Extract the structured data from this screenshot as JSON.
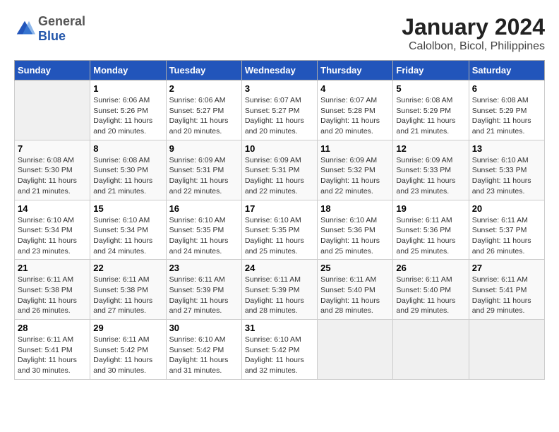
{
  "header": {
    "logo_general": "General",
    "logo_blue": "Blue",
    "title": "January 2024",
    "subtitle": "Calolbon, Bicol, Philippines"
  },
  "weekdays": [
    "Sunday",
    "Monday",
    "Tuesday",
    "Wednesday",
    "Thursday",
    "Friday",
    "Saturday"
  ],
  "weeks": [
    [
      {
        "num": "",
        "sunrise": "",
        "sunset": "",
        "daylight": ""
      },
      {
        "num": "1",
        "sunrise": "Sunrise: 6:06 AM",
        "sunset": "Sunset: 5:26 PM",
        "daylight": "Daylight: 11 hours and 20 minutes."
      },
      {
        "num": "2",
        "sunrise": "Sunrise: 6:06 AM",
        "sunset": "Sunset: 5:27 PM",
        "daylight": "Daylight: 11 hours and 20 minutes."
      },
      {
        "num": "3",
        "sunrise": "Sunrise: 6:07 AM",
        "sunset": "Sunset: 5:27 PM",
        "daylight": "Daylight: 11 hours and 20 minutes."
      },
      {
        "num": "4",
        "sunrise": "Sunrise: 6:07 AM",
        "sunset": "Sunset: 5:28 PM",
        "daylight": "Daylight: 11 hours and 20 minutes."
      },
      {
        "num": "5",
        "sunrise": "Sunrise: 6:08 AM",
        "sunset": "Sunset: 5:29 PM",
        "daylight": "Daylight: 11 hours and 21 minutes."
      },
      {
        "num": "6",
        "sunrise": "Sunrise: 6:08 AM",
        "sunset": "Sunset: 5:29 PM",
        "daylight": "Daylight: 11 hours and 21 minutes."
      }
    ],
    [
      {
        "num": "7",
        "sunrise": "Sunrise: 6:08 AM",
        "sunset": "Sunset: 5:30 PM",
        "daylight": "Daylight: 11 hours and 21 minutes."
      },
      {
        "num": "8",
        "sunrise": "Sunrise: 6:08 AM",
        "sunset": "Sunset: 5:30 PM",
        "daylight": "Daylight: 11 hours and 21 minutes."
      },
      {
        "num": "9",
        "sunrise": "Sunrise: 6:09 AM",
        "sunset": "Sunset: 5:31 PM",
        "daylight": "Daylight: 11 hours and 22 minutes."
      },
      {
        "num": "10",
        "sunrise": "Sunrise: 6:09 AM",
        "sunset": "Sunset: 5:31 PM",
        "daylight": "Daylight: 11 hours and 22 minutes."
      },
      {
        "num": "11",
        "sunrise": "Sunrise: 6:09 AM",
        "sunset": "Sunset: 5:32 PM",
        "daylight": "Daylight: 11 hours and 22 minutes."
      },
      {
        "num": "12",
        "sunrise": "Sunrise: 6:09 AM",
        "sunset": "Sunset: 5:33 PM",
        "daylight": "Daylight: 11 hours and 23 minutes."
      },
      {
        "num": "13",
        "sunrise": "Sunrise: 6:10 AM",
        "sunset": "Sunset: 5:33 PM",
        "daylight": "Daylight: 11 hours and 23 minutes."
      }
    ],
    [
      {
        "num": "14",
        "sunrise": "Sunrise: 6:10 AM",
        "sunset": "Sunset: 5:34 PM",
        "daylight": "Daylight: 11 hours and 23 minutes."
      },
      {
        "num": "15",
        "sunrise": "Sunrise: 6:10 AM",
        "sunset": "Sunset: 5:34 PM",
        "daylight": "Daylight: 11 hours and 24 minutes."
      },
      {
        "num": "16",
        "sunrise": "Sunrise: 6:10 AM",
        "sunset": "Sunset: 5:35 PM",
        "daylight": "Daylight: 11 hours and 24 minutes."
      },
      {
        "num": "17",
        "sunrise": "Sunrise: 6:10 AM",
        "sunset": "Sunset: 5:35 PM",
        "daylight": "Daylight: 11 hours and 25 minutes."
      },
      {
        "num": "18",
        "sunrise": "Sunrise: 6:10 AM",
        "sunset": "Sunset: 5:36 PM",
        "daylight": "Daylight: 11 hours and 25 minutes."
      },
      {
        "num": "19",
        "sunrise": "Sunrise: 6:11 AM",
        "sunset": "Sunset: 5:36 PM",
        "daylight": "Daylight: 11 hours and 25 minutes."
      },
      {
        "num": "20",
        "sunrise": "Sunrise: 6:11 AM",
        "sunset": "Sunset: 5:37 PM",
        "daylight": "Daylight: 11 hours and 26 minutes."
      }
    ],
    [
      {
        "num": "21",
        "sunrise": "Sunrise: 6:11 AM",
        "sunset": "Sunset: 5:38 PM",
        "daylight": "Daylight: 11 hours and 26 minutes."
      },
      {
        "num": "22",
        "sunrise": "Sunrise: 6:11 AM",
        "sunset": "Sunset: 5:38 PM",
        "daylight": "Daylight: 11 hours and 27 minutes."
      },
      {
        "num": "23",
        "sunrise": "Sunrise: 6:11 AM",
        "sunset": "Sunset: 5:39 PM",
        "daylight": "Daylight: 11 hours and 27 minutes."
      },
      {
        "num": "24",
        "sunrise": "Sunrise: 6:11 AM",
        "sunset": "Sunset: 5:39 PM",
        "daylight": "Daylight: 11 hours and 28 minutes."
      },
      {
        "num": "25",
        "sunrise": "Sunrise: 6:11 AM",
        "sunset": "Sunset: 5:40 PM",
        "daylight": "Daylight: 11 hours and 28 minutes."
      },
      {
        "num": "26",
        "sunrise": "Sunrise: 6:11 AM",
        "sunset": "Sunset: 5:40 PM",
        "daylight": "Daylight: 11 hours and 29 minutes."
      },
      {
        "num": "27",
        "sunrise": "Sunrise: 6:11 AM",
        "sunset": "Sunset: 5:41 PM",
        "daylight": "Daylight: 11 hours and 29 minutes."
      }
    ],
    [
      {
        "num": "28",
        "sunrise": "Sunrise: 6:11 AM",
        "sunset": "Sunset: 5:41 PM",
        "daylight": "Daylight: 11 hours and 30 minutes."
      },
      {
        "num": "29",
        "sunrise": "Sunrise: 6:11 AM",
        "sunset": "Sunset: 5:42 PM",
        "daylight": "Daylight: 11 hours and 30 minutes."
      },
      {
        "num": "30",
        "sunrise": "Sunrise: 6:10 AM",
        "sunset": "Sunset: 5:42 PM",
        "daylight": "Daylight: 11 hours and 31 minutes."
      },
      {
        "num": "31",
        "sunrise": "Sunrise: 6:10 AM",
        "sunset": "Sunset: 5:42 PM",
        "daylight": "Daylight: 11 hours and 32 minutes."
      },
      {
        "num": "",
        "sunrise": "",
        "sunset": "",
        "daylight": ""
      },
      {
        "num": "",
        "sunrise": "",
        "sunset": "",
        "daylight": ""
      },
      {
        "num": "",
        "sunrise": "",
        "sunset": "",
        "daylight": ""
      }
    ]
  ]
}
